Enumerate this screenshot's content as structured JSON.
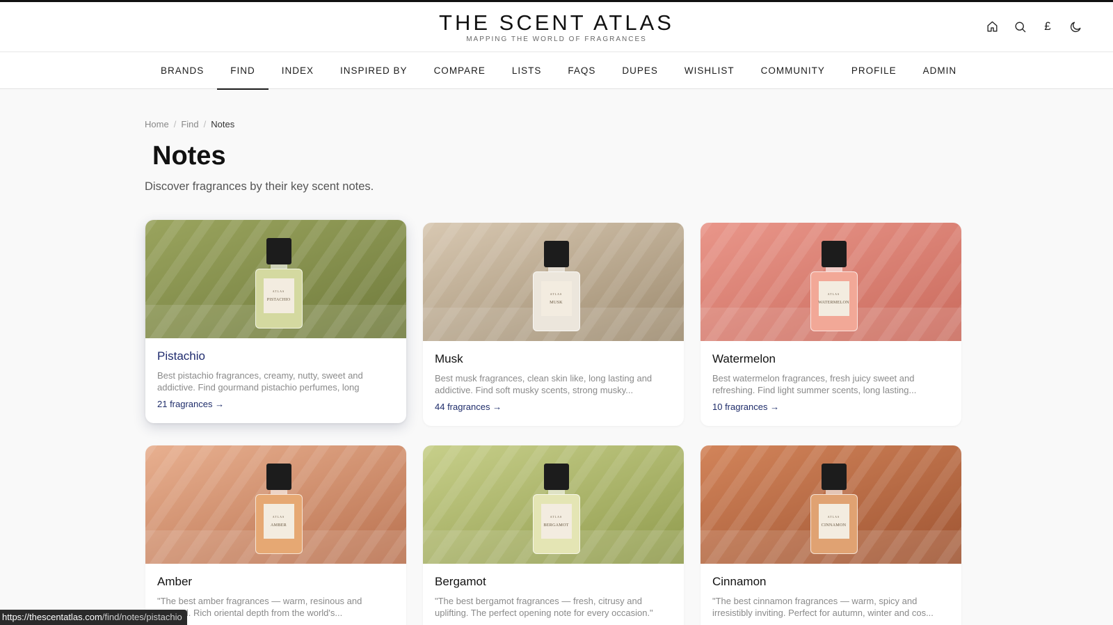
{
  "site": {
    "title": "THE SCENT ATLAS",
    "tagline": "MAPPING THE WORLD OF FRAGRANCES",
    "header_icons": [
      "home-icon",
      "search-icon",
      "currency-pound-icon",
      "dark-mode-moon-icon"
    ],
    "currency_symbol": "£"
  },
  "nav": {
    "items": [
      {
        "label": "BRANDS"
      },
      {
        "label": "FIND",
        "active": true
      },
      {
        "label": "INDEX"
      },
      {
        "label": "INSPIRED BY"
      },
      {
        "label": "COMPARE"
      },
      {
        "label": "LISTS"
      },
      {
        "label": "FAQS"
      },
      {
        "label": "DUPES"
      },
      {
        "label": "WISHLIST"
      },
      {
        "label": "COMMUNITY"
      },
      {
        "label": "PROFILE"
      },
      {
        "label": "ADMIN"
      }
    ]
  },
  "breadcrumb": {
    "home": "Home",
    "find": "Find",
    "current": "Notes",
    "separator": "/"
  },
  "page": {
    "title": "Notes",
    "subtitle": "Discover fragrances by their key scent notes."
  },
  "cards": [
    {
      "title": "Pistachio",
      "desc": "Best pistachio fragrances, creamy, nutty, sweet and addictive. Find gourmand pistachio perfumes, long lasting...",
      "count": "21 fragrances →",
      "bottle_brand": "ATLAS",
      "bottle_label": "PISTACHIO",
      "bg_from": "#9aa45e",
      "bg_to": "#6f7a3c",
      "glass": "#d4d9a0",
      "hover": true
    },
    {
      "title": "Musk",
      "desc": "Best musk fragrances, clean skin like, long lasting and addictive. Find soft musky scents, strong musky...",
      "count": "44 fragrances →",
      "bottle_brand": "ATLAS",
      "bottle_label": "MUSK",
      "bg_from": "#d8c8b2",
      "bg_to": "#9c8a6e",
      "glass": "#ece6dc",
      "hover": false
    },
    {
      "title": "Watermelon",
      "desc": "Best watermelon fragrances, fresh juicy sweet and refreshing. Find light summer scents, long lasting...",
      "count": "10 fragrances →",
      "bottle_brand": "ATLAS",
      "bottle_label": "WATERMELON",
      "bg_from": "#e9968a",
      "bg_to": "#c96a5c",
      "glass": "#f2a897",
      "hover": false
    },
    {
      "title": "Amber",
      "desc": "\"The best amber fragrances — warm, resinous and sensual. Rich oriental depth from the world's...",
      "count": "",
      "bottle_brand": "ATLAS",
      "bottle_label": "AMBER",
      "bg_from": "#e8b090",
      "bg_to": "#b8704e",
      "glass": "#e6a873",
      "hover": false
    },
    {
      "title": "Bergamot",
      "desc": "\"The best bergamot fragrances — fresh, citrusy and uplifting. The perfect opening note for every occasion.\"",
      "count": "",
      "bottle_brand": "ATLAS",
      "bottle_label": "BERGAMOT",
      "bg_from": "#c7cf8a",
      "bg_to": "#8f9a4c",
      "glass": "#e4e5b4",
      "hover": false
    },
    {
      "title": "Cinnamon",
      "desc": "\"The best cinnamon fragrances — warm, spicy and irresistibly inviting. Perfect for autumn, winter and cos...",
      "count": "",
      "bottle_brand": "ATLAS",
      "bottle_label": "CINNAMON",
      "bg_from": "#d2845a",
      "bg_to": "#9e5432",
      "glass": "#e0a272",
      "hover": false
    }
  ],
  "status_bar": {
    "host": "https://thescentatlas.com",
    "path": "/find/notes/pistachio"
  }
}
